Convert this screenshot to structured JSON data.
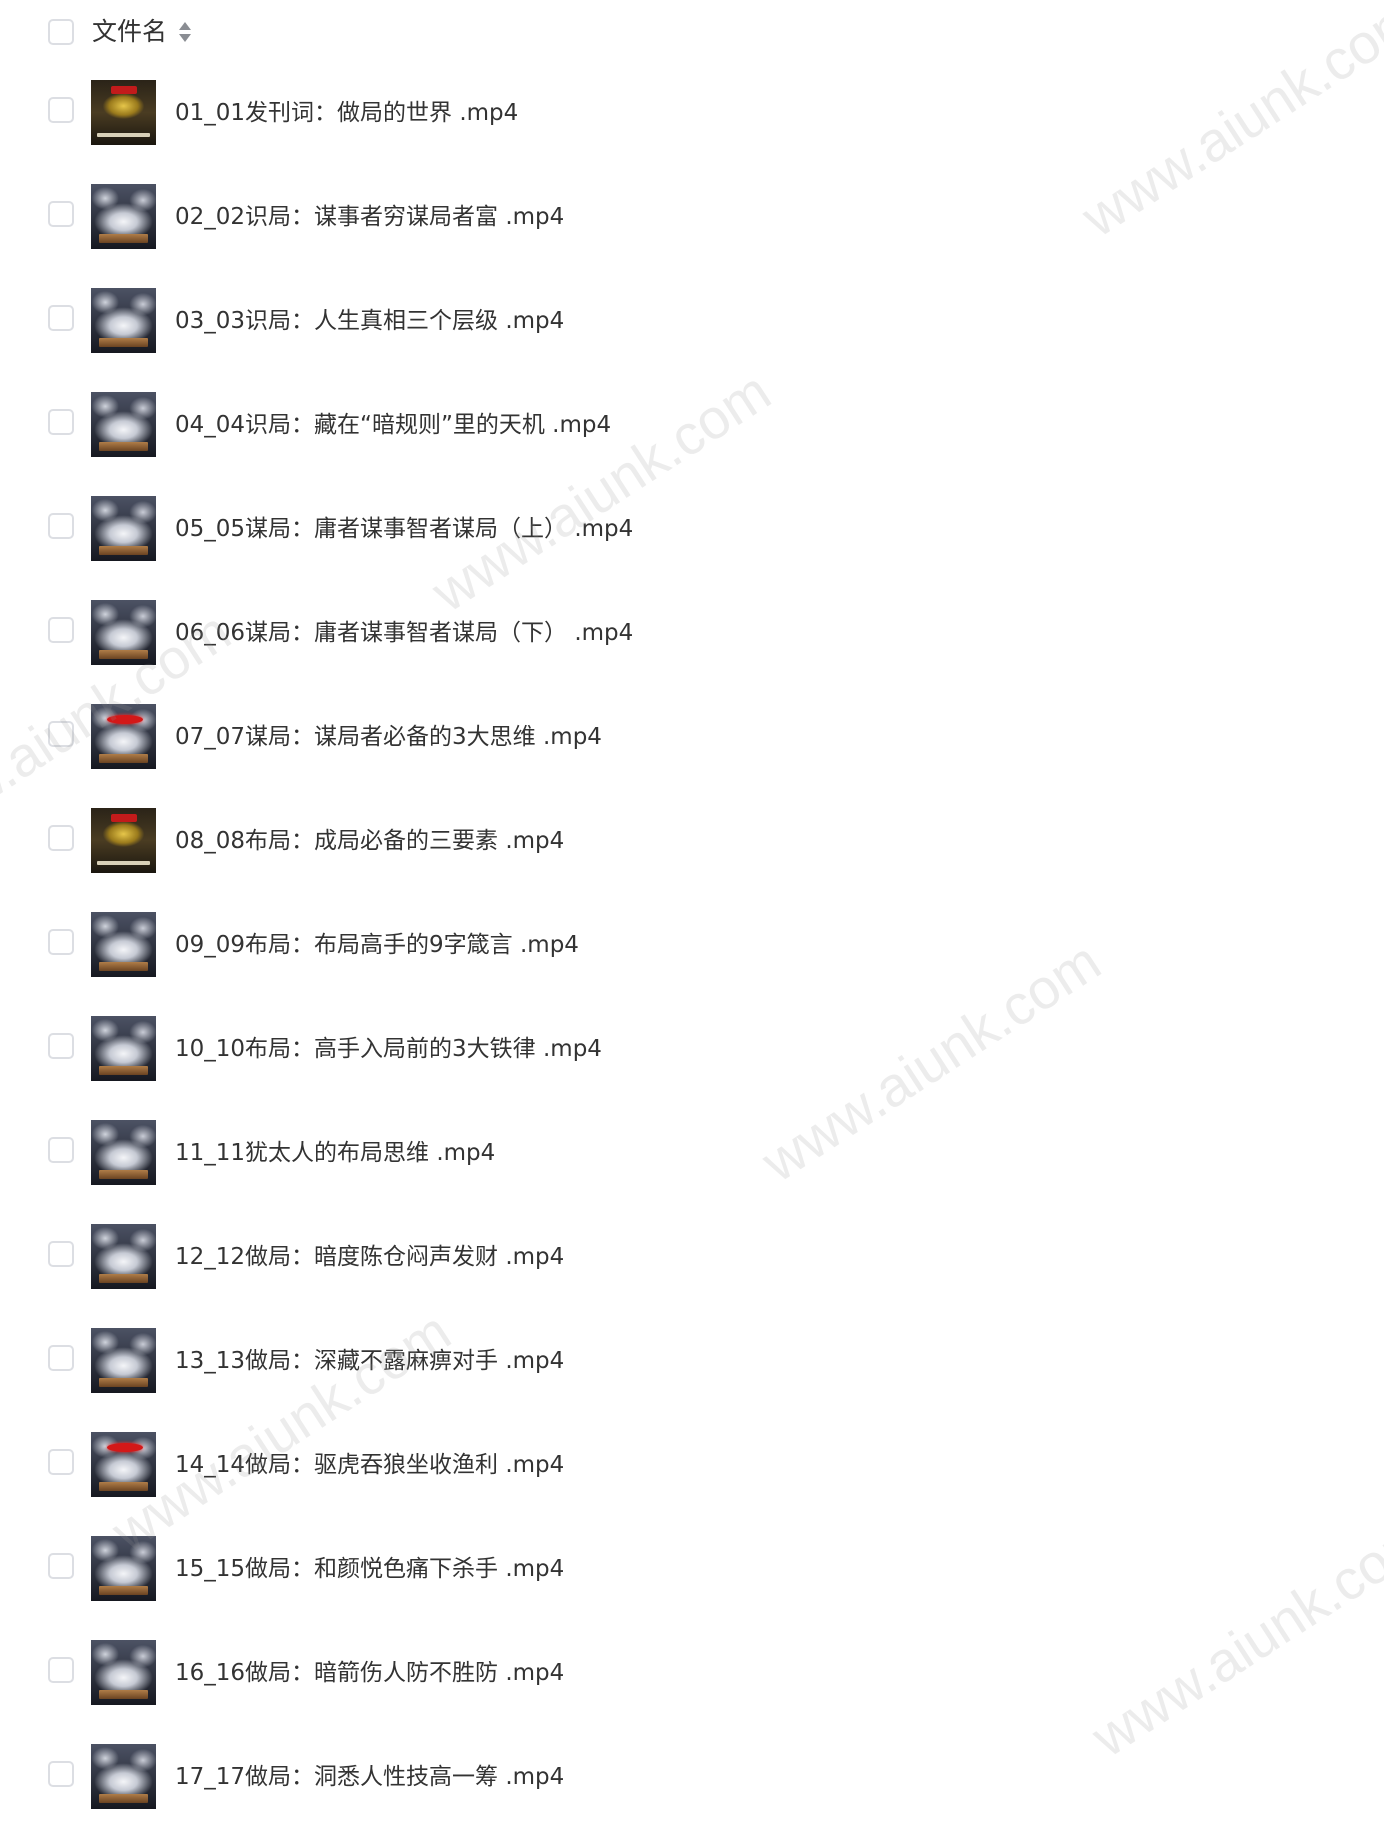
{
  "header": {
    "column_label": "文件名"
  },
  "files": [
    {
      "name": "01_01发刊词：做局的世界 .mp4",
      "thumb": "poster"
    },
    {
      "name": "02_02识局：谋事者穷谋局者富 .mp4",
      "thumb": "normal"
    },
    {
      "name": "03_03识局：人生真相三个层级 .mp4",
      "thumb": "normal"
    },
    {
      "name": "04_04识局：藏在“暗规则”里的天机 .mp4",
      "thumb": "normal"
    },
    {
      "name": "05_05谋局：庸者谋事智者谋局（上） .mp4",
      "thumb": "normal"
    },
    {
      "name": "06_06谋局：庸者谋事智者谋局（下） .mp4",
      "thumb": "normal"
    },
    {
      "name": "07_07谋局：谋局者必备的3大思维 .mp4",
      "thumb": "red"
    },
    {
      "name": "08_08布局：成局必备的三要素 .mp4",
      "thumb": "poster"
    },
    {
      "name": "09_09布局：布局高手的9字箴言 .mp4",
      "thumb": "normal"
    },
    {
      "name": "10_10布局：高手入局前的3大铁律 .mp4",
      "thumb": "normal"
    },
    {
      "name": "11_11犹太人的布局思维 .mp4",
      "thumb": "normal"
    },
    {
      "name": "12_12做局：暗度陈仓闷声发财 .mp4",
      "thumb": "normal"
    },
    {
      "name": "13_13做局：深藏不露麻痹对手 .mp4",
      "thumb": "normal"
    },
    {
      "name": "14_14做局：驱虎吞狼坐收渔利 .mp4",
      "thumb": "red"
    },
    {
      "name": "15_15做局：和颜悦色痛下杀手 .mp4",
      "thumb": "normal"
    },
    {
      "name": "16_16做局：暗箭伤人防不胜防 .mp4",
      "thumb": "normal"
    },
    {
      "name": "17_17做局：洞悉人性技高一筹 .mp4",
      "thumb": "normal"
    }
  ],
  "watermark_text": "www.aiunk.com"
}
